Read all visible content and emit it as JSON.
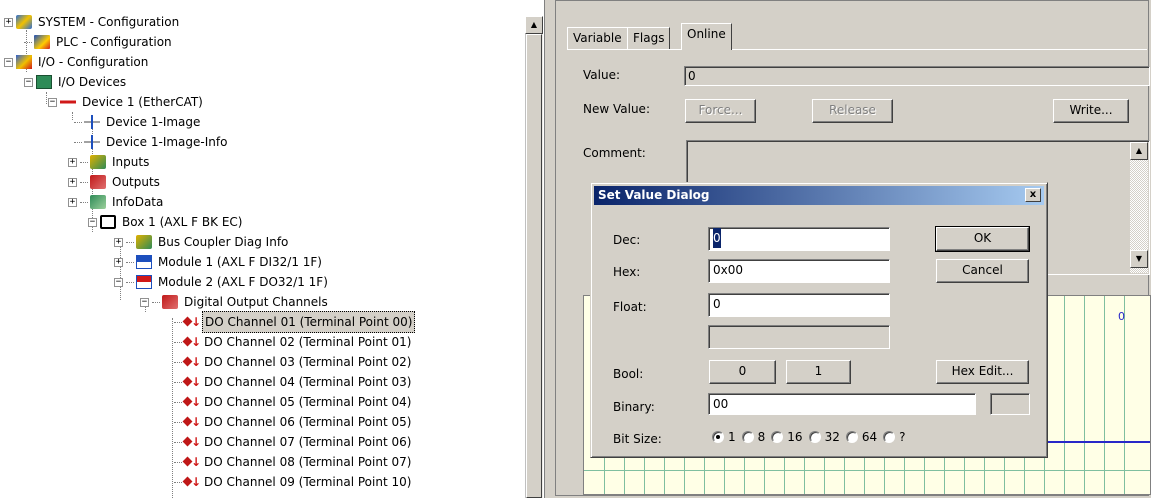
{
  "tree": {
    "items": [
      {
        "label": "SYSTEM - Configuration",
        "expander": "+"
      },
      {
        "label": "PLC - Configuration",
        "expander": ""
      },
      {
        "label": "I/O - Configuration",
        "expander": "−"
      },
      {
        "label": "I/O Devices",
        "expander": "−"
      },
      {
        "label": "Device 1 (EtherCAT)",
        "expander": "−"
      },
      {
        "label": "Device 1-Image",
        "expander": ""
      },
      {
        "label": "Device 1-Image-Info",
        "expander": ""
      },
      {
        "label": "Inputs",
        "expander": "+"
      },
      {
        "label": "Outputs",
        "expander": "+"
      },
      {
        "label": "InfoData",
        "expander": "+"
      },
      {
        "label": "Box 1 (AXL F BK EC)",
        "expander": "−"
      },
      {
        "label": "Bus Coupler Diag Info",
        "expander": "+"
      },
      {
        "label": "Module 1 (AXL F DI32/1 1F)",
        "expander": "+"
      },
      {
        "label": "Module 2 (AXL F DO32/1 1F)",
        "expander": "−"
      },
      {
        "label": "Digital Output Channels",
        "expander": "−"
      },
      {
        "label": "DO Channel 01 (Terminal Point 00)",
        "expander": "",
        "selected": true
      },
      {
        "label": "DO Channel 02 (Terminal Point 01)",
        "expander": ""
      },
      {
        "label": "DO Channel 03 (Terminal Point 02)",
        "expander": ""
      },
      {
        "label": "DO Channel 04 (Terminal Point 03)",
        "expander": ""
      },
      {
        "label": "DO Channel 05 (Terminal Point 04)",
        "expander": ""
      },
      {
        "label": "DO Channel 06 (Terminal Point 05)",
        "expander": ""
      },
      {
        "label": "DO Channel 07 (Terminal Point 06)",
        "expander": ""
      },
      {
        "label": "DO Channel 08 (Terminal Point 07)",
        "expander": ""
      },
      {
        "label": "DO Channel 09 (Terminal Point 10)",
        "expander": ""
      }
    ]
  },
  "tabs": [
    "Variable",
    "Flags",
    "Online"
  ],
  "online": {
    "value_label": "Value:",
    "value": "0",
    "new_value_label": "New Value:",
    "force_label": "Force...",
    "release_label": "Release",
    "write_label": "Write...",
    "comment_label": "Comment:",
    "grid_value": "0"
  },
  "dialog": {
    "title": "Set Value Dialog",
    "close_label": "x",
    "dec_label": "Dec:",
    "dec_value": "0",
    "hex_label": "Hex:",
    "hex_value": "0x00",
    "float_label": "Float:",
    "float_value": "0",
    "ok_label": "OK",
    "cancel_label": "Cancel",
    "bool_label": "Bool:",
    "bool_0": "0",
    "bool_1": "1",
    "hex_edit_label": "Hex Edit...",
    "binary_label": "Binary:",
    "binary_value": "00",
    "bitsize_label": "Bit Size:",
    "bit_sizes": [
      "1",
      "8",
      "16",
      "32",
      "64",
      "?"
    ],
    "bit_size_selected": "1"
  }
}
